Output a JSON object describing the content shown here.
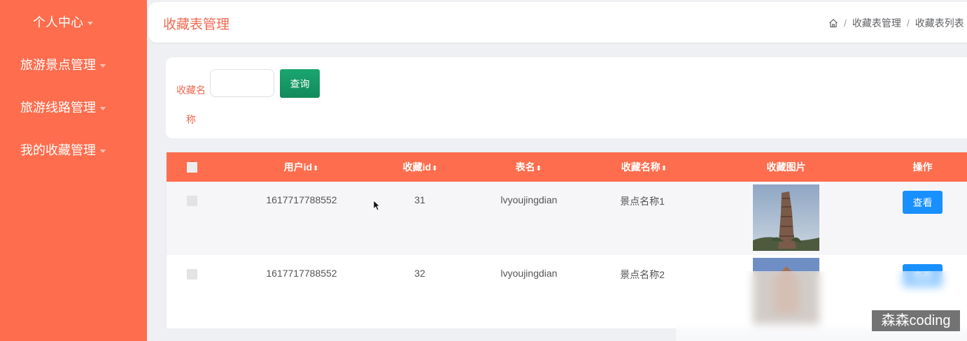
{
  "sidebar": {
    "items": [
      {
        "label": "个人中心"
      },
      {
        "label": "旅游景点管理"
      },
      {
        "label": "旅游线路管理"
      },
      {
        "label": "我的收藏管理"
      }
    ]
  },
  "header": {
    "title": "收藏表管理",
    "breadcrumb": [
      "收藏表管理",
      "收藏表列表"
    ]
  },
  "search": {
    "label": "收藏名称",
    "input_value": "",
    "button_label": "查询"
  },
  "table": {
    "columns": [
      "用户id",
      "收藏id",
      "表名",
      "收藏名称",
      "收藏图片",
      "操作"
    ],
    "rows": [
      {
        "user_id": "1617717788552",
        "fav_id": "31",
        "table_name": "lvyoujingdian",
        "fav_name": "景点名称1",
        "action": "查看"
      },
      {
        "user_id": "1617717788552",
        "fav_id": "32",
        "table_name": "lvyoujingdian",
        "fav_name": "景点名称2",
        "action": "查看"
      }
    ]
  },
  "watermark": "森森coding",
  "colors": {
    "accent": "#fe6d4d",
    "title": "#ee6a51",
    "search_button": "#1aa670",
    "view_button": "#1890ff"
  }
}
